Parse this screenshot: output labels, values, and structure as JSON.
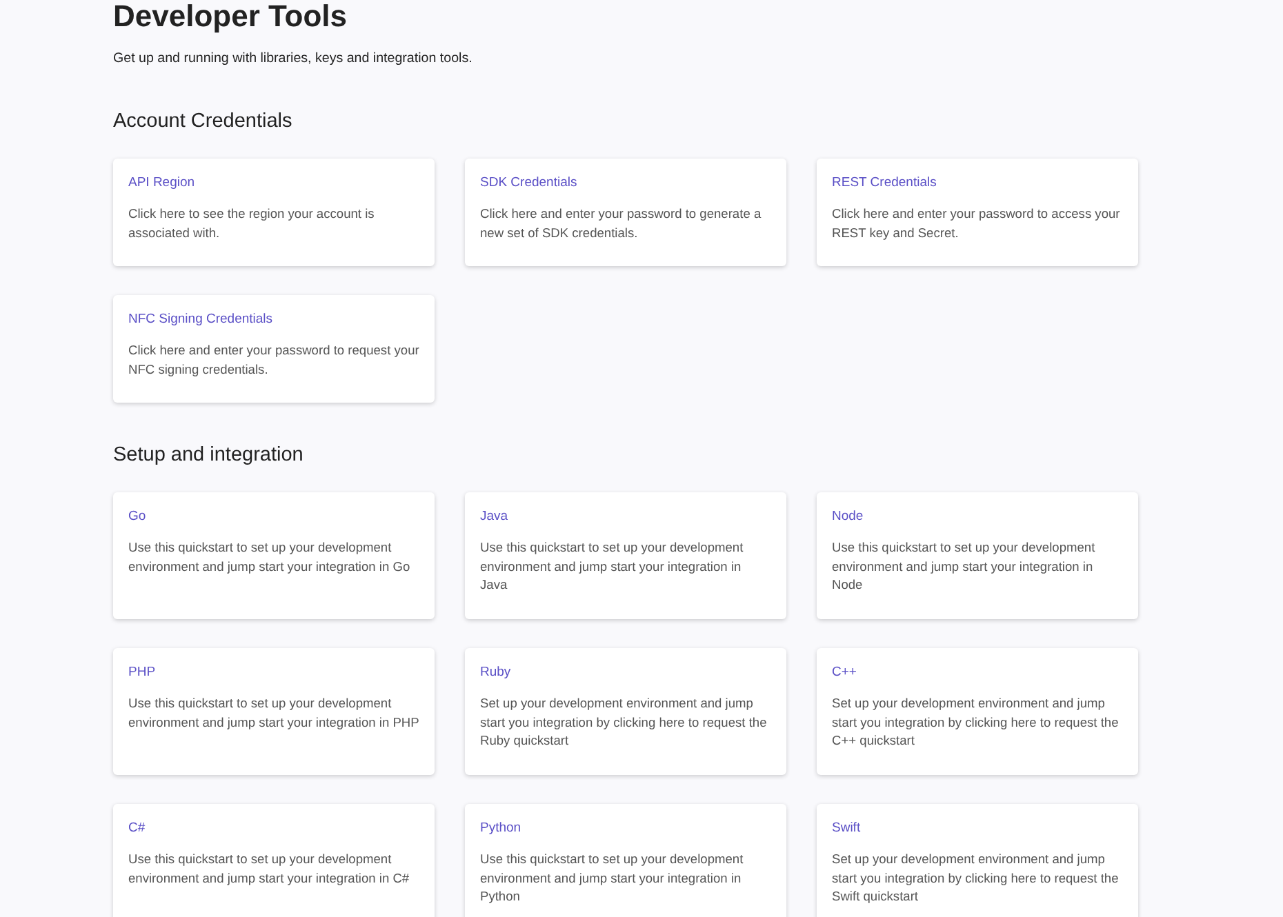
{
  "title": "Developer Tools",
  "subtitle": "Get up and running with libraries, keys and integration tools.",
  "sections": [
    {
      "heading": "Account Credentials",
      "cards": [
        {
          "title": "API Region",
          "description": "Click here to see the region your account is associated with."
        },
        {
          "title": "SDK Credentials",
          "description": "Click here and enter your password to generate a new set of SDK credentials."
        },
        {
          "title": "REST Credentials",
          "description": "Click here and enter your password to access your REST key and Secret."
        },
        {
          "title": "NFC Signing Credentials",
          "description": "Click here and enter your password to request your NFC signing credentials."
        }
      ]
    },
    {
      "heading": "Setup and integration",
      "cards": [
        {
          "title": "Go",
          "description": "Use this quickstart to set up your development environment and jump start your integration in Go"
        },
        {
          "title": "Java",
          "description": "Use this quickstart to set up your development environment and jump start your integration in Java"
        },
        {
          "title": "Node",
          "description": "Use this quickstart to set up your development environment and jump start your integration in Node"
        },
        {
          "title": "PHP",
          "description": "Use this quickstart to set up your development environment and jump start your integration in PHP"
        },
        {
          "title": "Ruby",
          "description": "Set up your development environment and jump start you integration by clicking here to request the Ruby quickstart"
        },
        {
          "title": "C++",
          "description": "Set up your development environment and jump start you integration by clicking here to request the C++ quickstart"
        },
        {
          "title": "C#",
          "description": "Use this quickstart to set up your development environment and jump start your integration in C#"
        },
        {
          "title": "Python",
          "description": "Use this quickstart to set up your development environment and jump start your integration in Python"
        },
        {
          "title": "Swift",
          "description": "Set up your development environment and jump start you integration by clicking here to request the Swift quickstart"
        }
      ]
    }
  ]
}
